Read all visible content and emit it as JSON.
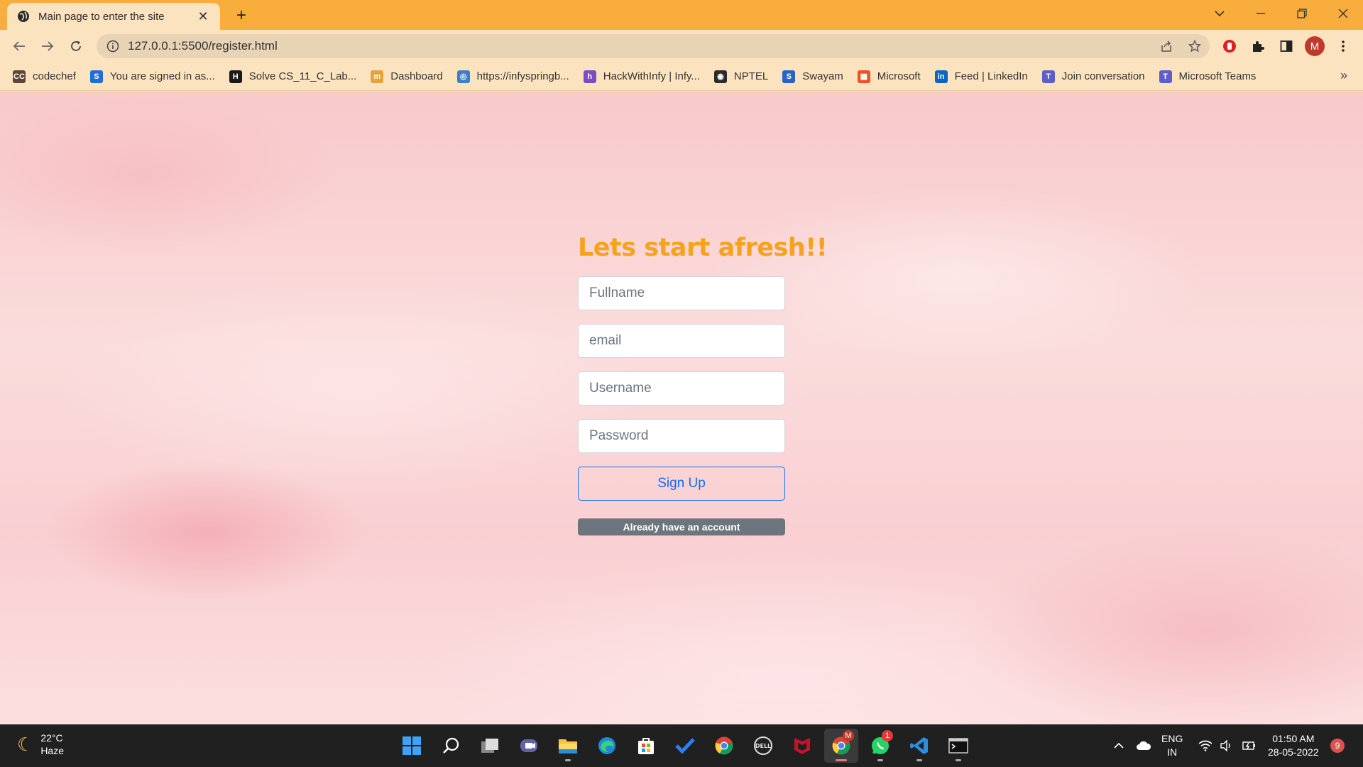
{
  "browser": {
    "tab_title": "Main page to enter the site",
    "url": "127.0.0.1:5500/register.html",
    "profile_initial": "M",
    "colors": {
      "tabstrip": "#f9ad3c",
      "toolbar": "#fbe3bf"
    }
  },
  "bookmarks": [
    {
      "label": "codechef",
      "icon": "codechef-icon",
      "color": "#5b4638",
      "glyph": "CC"
    },
    {
      "label": "You are signed in as...",
      "icon": "s-icon",
      "color": "#1e6fd9",
      "glyph": "S"
    },
    {
      "label": "Solve CS_11_C_Lab...",
      "icon": "hackerrank-icon",
      "color": "#1a1a1a",
      "glyph": "H"
    },
    {
      "label": "Dashboard",
      "icon": "dashboard-icon",
      "color": "#e8a23a",
      "glyph": "m"
    },
    {
      "label": "https://infyspringb...",
      "icon": "globe-icon",
      "color": "#3b7fc4",
      "glyph": "◎"
    },
    {
      "label": "HackWithInfy | Infy...",
      "icon": "hackwithinfy-icon",
      "color": "#7b4cc2",
      "glyph": "h"
    },
    {
      "label": "NPTEL",
      "icon": "nptel-icon",
      "color": "#2b2b2b",
      "glyph": "◉"
    },
    {
      "label": "Swayam",
      "icon": "swayam-icon",
      "color": "#2a62c9",
      "glyph": "S"
    },
    {
      "label": "Microsoft",
      "icon": "microsoft-icon",
      "color": "#f25022",
      "glyph": "▦"
    },
    {
      "label": "Feed | LinkedIn",
      "icon": "linkedin-icon",
      "color": "#0a66c2",
      "glyph": "in"
    },
    {
      "label": "Join conversation",
      "icon": "teams-icon",
      "color": "#5b5fc7",
      "glyph": "T"
    },
    {
      "label": "Microsoft Teams",
      "icon": "teams-icon",
      "color": "#5b5fc7",
      "glyph": "T"
    }
  ],
  "form": {
    "title": "Lets start afresh!!",
    "title_color": "#f7a21b",
    "fields": [
      {
        "placeholder": "Fullname"
      },
      {
        "placeholder": "email"
      },
      {
        "placeholder": "Username"
      },
      {
        "placeholder": "Password"
      }
    ],
    "signup_label": "Sign Up",
    "already_label": "Already have an account"
  },
  "taskbar": {
    "weather_temp": "22°C",
    "weather_desc": "Haze",
    "whatsapp_badge": "1",
    "chrome_badge": "M",
    "lang": "ENG",
    "region": "IN",
    "time": "01:50 AM",
    "date": "28-05-2022",
    "notifications": "9"
  }
}
